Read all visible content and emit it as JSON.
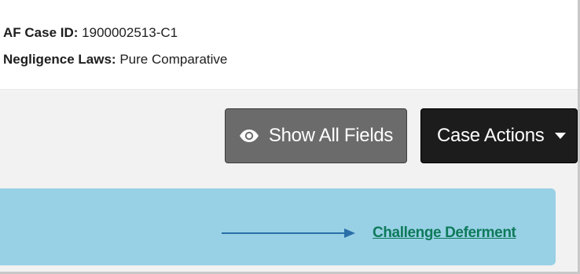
{
  "case_info": {
    "case_id_label": "AF Case ID:",
    "case_id_value": "1900002513-C1",
    "negligence_label": "Negligence Laws:",
    "negligence_value": "Pure Comparative"
  },
  "toolbar": {
    "show_all_fields_label": "Show All Fields",
    "show_all_fields_icon": "eye-icon",
    "case_actions_label": "Case Actions",
    "case_actions_icon": "caret-down-icon"
  },
  "alert": {
    "link_label": "Challenge Deferment",
    "arrow_icon": "arrow-right-icon",
    "background_color": "#98d1e6",
    "link_color": "#0e7a5a",
    "arrow_color": "#2a6fa8"
  }
}
